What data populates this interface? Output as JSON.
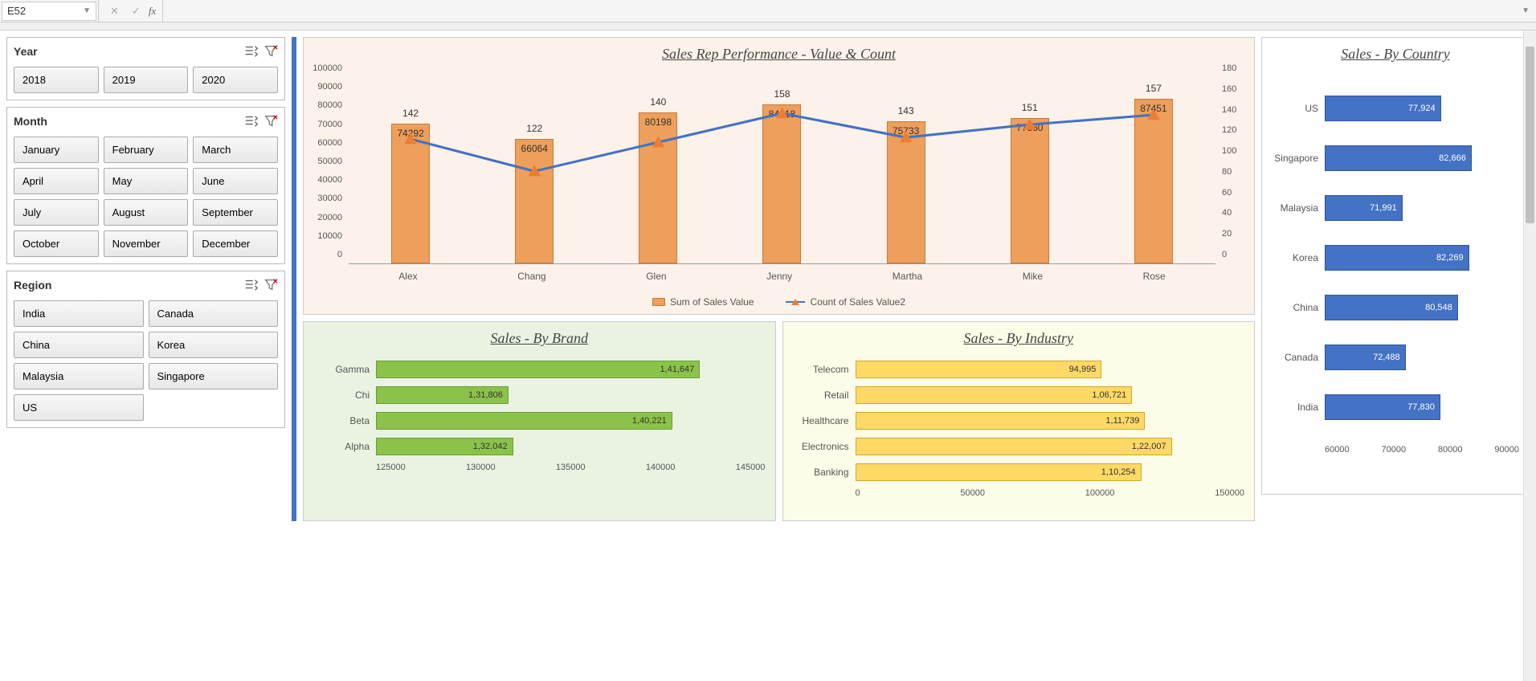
{
  "formula_bar": {
    "name_box": "E52",
    "fx": "fx",
    "cancel": "✕",
    "accept": "✓",
    "value": ""
  },
  "slicers": {
    "year": {
      "title": "Year",
      "items": [
        "2018",
        "2019",
        "2020"
      ]
    },
    "month": {
      "title": "Month",
      "items": [
        "January",
        "February",
        "March",
        "April",
        "May",
        "June",
        "July",
        "August",
        "September",
        "October",
        "November",
        "December"
      ]
    },
    "region": {
      "title": "Region",
      "items": [
        "India",
        "Canada",
        "China",
        "Korea",
        "Malaysia",
        "Singapore",
        "US"
      ]
    }
  },
  "chart_data": [
    {
      "id": "combo",
      "type": "bar+line",
      "title": "Sales Rep Performance - Value & Count",
      "categories": [
        "Alex",
        "Chang",
        "Glen",
        "Jenny",
        "Martha",
        "Mike",
        "Rose"
      ],
      "series": [
        {
          "name": "Sum of Sales Value",
          "kind": "bar",
          "values": [
            74292,
            66064,
            80198,
            84618,
            75733,
            77360,
            87451
          ]
        },
        {
          "name": "Count of Sales Value2",
          "kind": "line",
          "values": [
            142,
            122,
            140,
            158,
            143,
            151,
            157
          ]
        }
      ],
      "y_left": {
        "min": 0,
        "max": 100000,
        "step": 10000
      },
      "y_right": {
        "min": 0,
        "max": 180,
        "step": 20
      },
      "legend": [
        "Sum of Sales Value",
        "Count of Sales Value2"
      ]
    },
    {
      "id": "brand",
      "type": "bar-horizontal",
      "title": "Sales - By Brand",
      "categories": [
        "Gamma",
        "Chi",
        "Beta",
        "Alpha"
      ],
      "values": [
        141647,
        131806,
        140221,
        132042
      ],
      "value_labels": [
        "1,41,647",
        "1,31,806",
        "1,40,221",
        "1,32,042"
      ],
      "xlim": [
        125000,
        145000
      ],
      "xticks": [
        "125000",
        "130000",
        "135000",
        "140000",
        "145000"
      ]
    },
    {
      "id": "industry",
      "type": "bar-horizontal",
      "title": "Sales - By Industry",
      "categories": [
        "Telecom",
        "Retail",
        "Healthcare",
        "Electronics",
        "Banking"
      ],
      "values": [
        94995,
        106721,
        111739,
        122007,
        110254
      ],
      "value_labels": [
        "94,995",
        "1,06,721",
        "1,11,739",
        "1,22,007",
        "1,10,254"
      ],
      "xlim": [
        0,
        150000
      ],
      "xticks": [
        "0",
        "50000",
        "100000",
        "150000"
      ]
    },
    {
      "id": "country",
      "type": "bar-horizontal",
      "title": "Sales - By Country",
      "categories": [
        "US",
        "Singapore",
        "Malaysia",
        "Korea",
        "China",
        "Canada",
        "India"
      ],
      "values": [
        77924,
        82666,
        71991,
        82269,
        80548,
        72488,
        77830
      ],
      "value_labels": [
        "77,924",
        "82,666",
        "71,991",
        "82,269",
        "80,548",
        "72,488",
        "77,830"
      ],
      "xlim": [
        60000,
        90000
      ],
      "xticks": [
        "60000",
        "70000",
        "80000",
        "90000"
      ]
    }
  ]
}
